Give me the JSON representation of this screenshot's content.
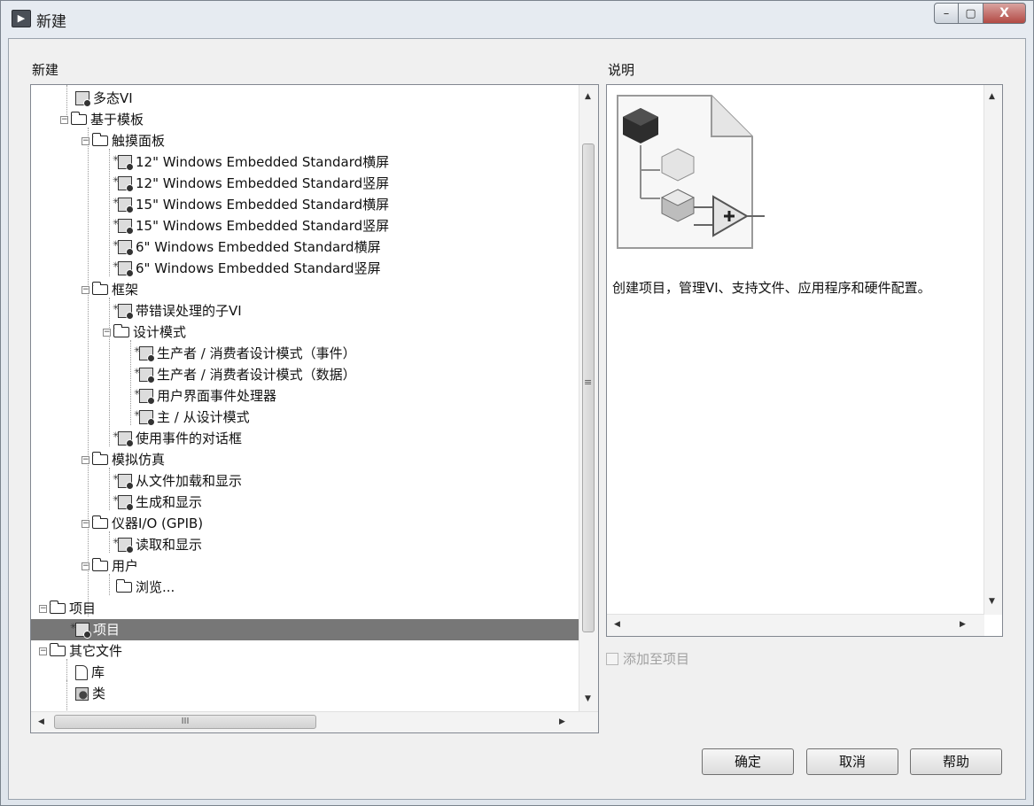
{
  "window": {
    "title": "新建",
    "icon": "labview-app-icon",
    "controls": {
      "minimize": "–",
      "maximize": "▢",
      "close": "X"
    }
  },
  "new_panel": {
    "label": "新建"
  },
  "description_panel": {
    "label": "说明",
    "text": "创建项目，管理VI、支持文件、应用程序和硬件配置。",
    "image": "project-hierarchy-icon"
  },
  "tree": {
    "items": [
      {
        "label": "多态VI",
        "type": "vi"
      },
      {
        "label": "基于模板",
        "type": "folder",
        "expanded": true
      },
      {
        "label": "触摸面板",
        "type": "folder",
        "expanded": true
      },
      {
        "label": "12\" Windows Embedded Standard横屏",
        "type": "template"
      },
      {
        "label": "12\" Windows Embedded Standard竖屏",
        "type": "template"
      },
      {
        "label": "15\" Windows Embedded Standard横屏",
        "type": "template"
      },
      {
        "label": "15\" Windows Embedded Standard竖屏",
        "type": "template"
      },
      {
        "label": "6\" Windows Embedded Standard横屏",
        "type": "template"
      },
      {
        "label": "6\" Windows Embedded Standard竖屏",
        "type": "template"
      },
      {
        "label": "框架",
        "type": "folder",
        "expanded": true
      },
      {
        "label": "带错误处理的子VI",
        "type": "template"
      },
      {
        "label": "设计模式",
        "type": "folder",
        "expanded": true
      },
      {
        "label": "生产者 / 消费者设计模式（事件）",
        "type": "template"
      },
      {
        "label": "生产者 / 消费者设计模式（数据）",
        "type": "template"
      },
      {
        "label": "用户界面事件处理器",
        "type": "template"
      },
      {
        "label": "主 / 从设计模式",
        "type": "template"
      },
      {
        "label": "使用事件的对话框",
        "type": "template"
      },
      {
        "label": "模拟仿真",
        "type": "folder",
        "expanded": true
      },
      {
        "label": "从文件加载和显示",
        "type": "template"
      },
      {
        "label": "生成和显示",
        "type": "template"
      },
      {
        "label": "仪器I/O (GPIB)",
        "type": "folder",
        "expanded": true
      },
      {
        "label": "读取和显示",
        "type": "template"
      },
      {
        "label": "用户",
        "type": "folder",
        "expanded": true
      },
      {
        "label": "浏览...",
        "type": "folder"
      },
      {
        "label": "项目",
        "type": "folder",
        "expanded": true
      },
      {
        "label": "项目",
        "type": "project",
        "selected": true
      },
      {
        "label": "其它文件",
        "type": "folder",
        "expanded": true
      },
      {
        "label": "库",
        "type": "library"
      },
      {
        "label": "类",
        "type": "class"
      }
    ]
  },
  "add_to_project": {
    "label": "添加至项目",
    "checked": false,
    "enabled": false
  },
  "buttons": {
    "ok": "确定",
    "cancel": "取消",
    "help": "帮助"
  },
  "scrollbar_glyphs": {
    "up": "▲",
    "down": "▼",
    "left": "◀",
    "right": "▶",
    "grip_v": "≡",
    "grip_h": "III"
  },
  "colors": {
    "selection": "#777777",
    "disabled_text": "#a0a0a0"
  }
}
